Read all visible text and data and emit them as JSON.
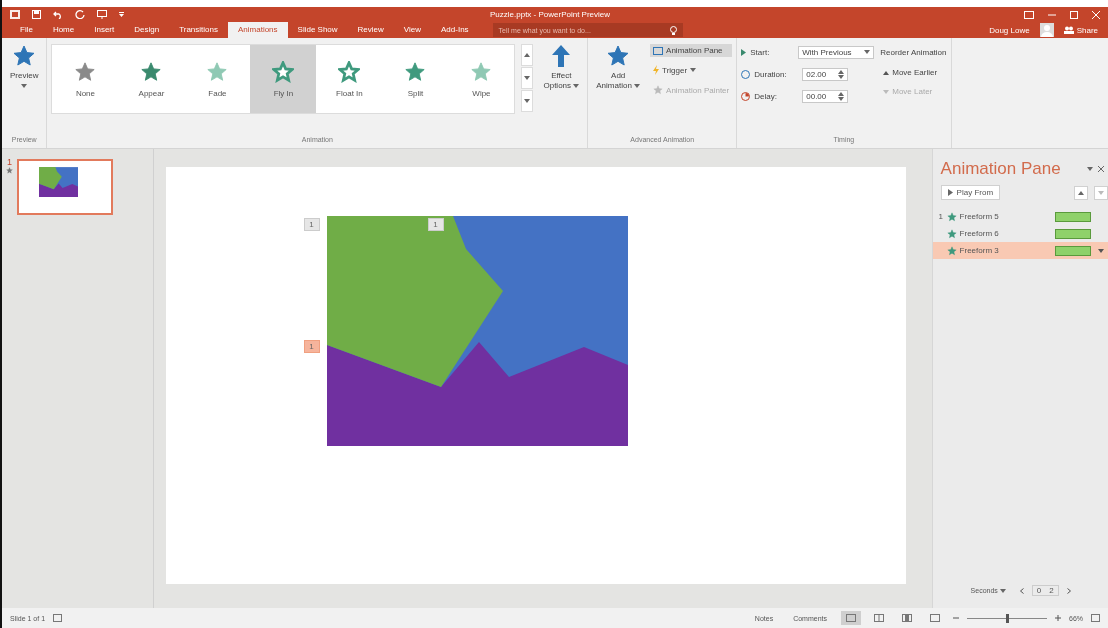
{
  "window": {
    "title": "Puzzle.pptx - PowerPoint Preview"
  },
  "tabs": [
    {
      "label": "File",
      "selected": false
    },
    {
      "label": "Home",
      "selected": false
    },
    {
      "label": "Insert",
      "selected": false
    },
    {
      "label": "Design",
      "selected": false
    },
    {
      "label": "Transitions",
      "selected": false
    },
    {
      "label": "Animations",
      "selected": true
    },
    {
      "label": "Slide Show",
      "selected": false
    },
    {
      "label": "Review",
      "selected": false
    },
    {
      "label": "View",
      "selected": false
    },
    {
      "label": "Add-Ins",
      "selected": false
    }
  ],
  "tell_me": {
    "placeholder": "Tell me what you want to do..."
  },
  "user": {
    "name": "Doug Lowe",
    "share": "Share"
  },
  "ribbon": {
    "preview": {
      "label": "Preview",
      "group": "Preview"
    },
    "animation": {
      "group": "Animation",
      "items": [
        {
          "label": "None",
          "kind": "none",
          "selected": false
        },
        {
          "label": "Appear",
          "kind": "appear",
          "selected": false
        },
        {
          "label": "Fade",
          "kind": "fade",
          "selected": false
        },
        {
          "label": "Fly In",
          "kind": "fly",
          "selected": true
        },
        {
          "label": "Float In",
          "kind": "float",
          "selected": false
        },
        {
          "label": "Split",
          "kind": "split",
          "selected": false
        },
        {
          "label": "Wipe",
          "kind": "wipe",
          "selected": false
        }
      ],
      "effect_options": [
        "Effect",
        "Options"
      ]
    },
    "advanced": {
      "group": "Advanced Animation",
      "add": [
        "Add",
        "Animation"
      ],
      "pane": {
        "label": "Animation Pane",
        "selected": true
      },
      "trigger": {
        "label": "Trigger",
        "disabled": false
      },
      "painter": {
        "label": "Animation Painter",
        "disabled": true
      }
    },
    "timing": {
      "group": "Timing",
      "start": {
        "label": "Start:",
        "value": "With Previous"
      },
      "duration": {
        "label": "Duration:",
        "value": "02.00"
      },
      "delay": {
        "label": "Delay:",
        "value": "00.00"
      },
      "reorder": "Reorder Animation",
      "move_earlier": {
        "label": "Move Earlier",
        "disabled": false
      },
      "move_later": {
        "label": "Move Later",
        "disabled": true
      }
    }
  },
  "slides": [
    {
      "number": "1",
      "selected": true
    }
  ],
  "slide_tags": [
    {
      "label": "1",
      "selected": false
    },
    {
      "label": "1",
      "selected": false
    },
    {
      "label": "1",
      "selected": true
    }
  ],
  "animation_pane": {
    "title": "Animation Pane",
    "play_from": "Play From",
    "items": [
      {
        "order": "1",
        "name": "Freeform 5",
        "selected": false
      },
      {
        "name": "Freeform 6",
        "selected": false
      },
      {
        "name": "Freeform 3",
        "selected": true
      }
    ],
    "seconds": "Seconds",
    "timeline": [
      "0",
      "2"
    ]
  },
  "status_bar": {
    "slide": "Slide 1 of 1",
    "notes": "Notes",
    "comments": "Comments",
    "views": [
      {
        "kind": "normal",
        "selected": true
      },
      {
        "kind": "sorter",
        "selected": false
      },
      {
        "kind": "reading",
        "selected": false
      },
      {
        "kind": "show",
        "selected": false
      }
    ],
    "zoom": {
      "level": 0.5,
      "label": "66%"
    }
  }
}
